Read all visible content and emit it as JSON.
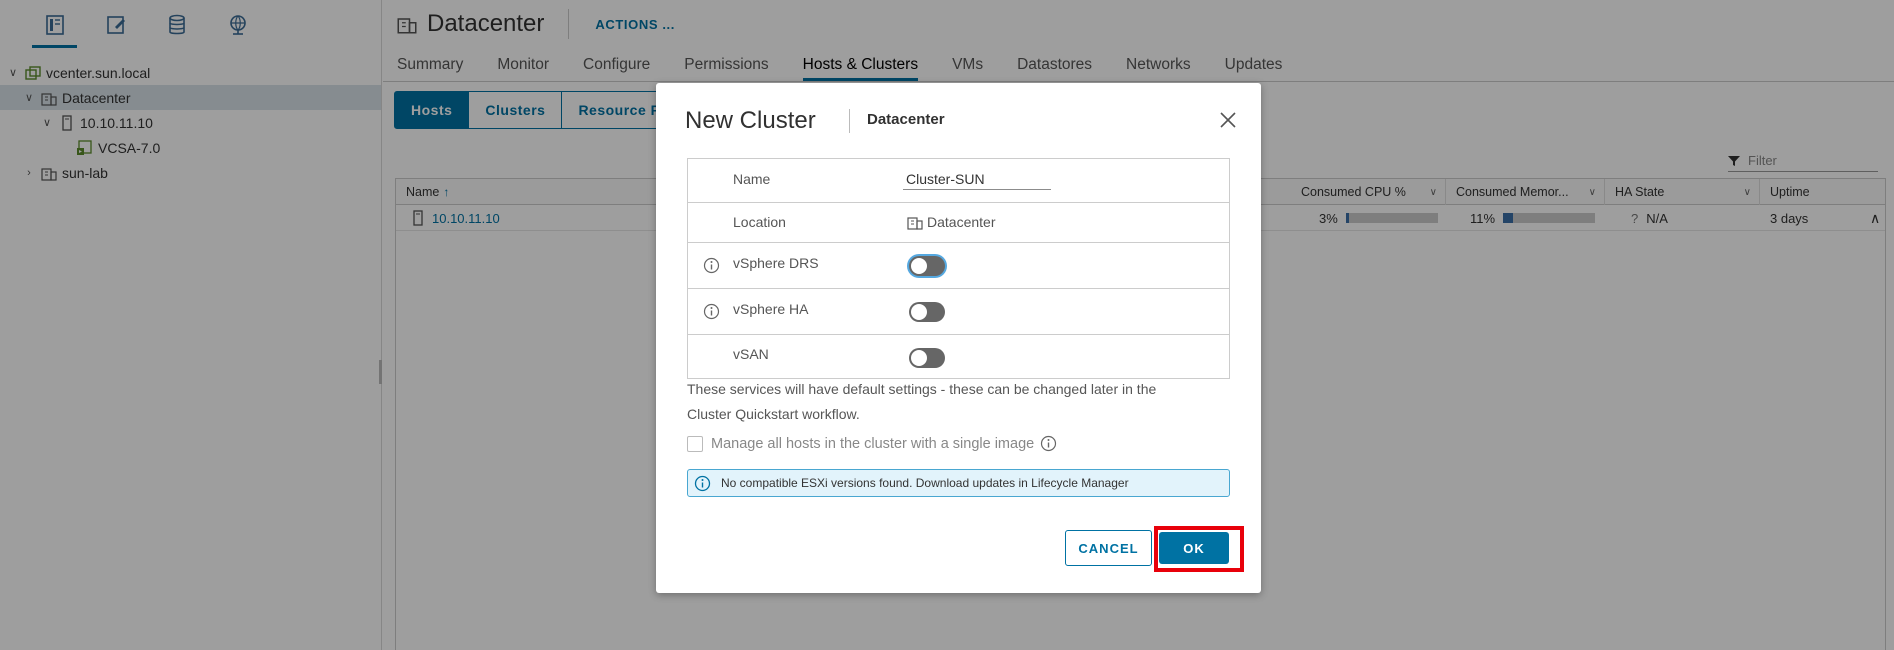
{
  "navigator": {
    "tabs": [
      "hosts-and-clusters",
      "vms-and-templates",
      "storage",
      "networking"
    ],
    "tree": [
      {
        "label": "vcenter.sun.local",
        "icon": "vcenter-icon",
        "level": 0,
        "expanded": true
      },
      {
        "label": "Datacenter",
        "icon": "datacenter-icon",
        "level": 1,
        "expanded": true,
        "selected": true
      },
      {
        "label": "10.10.11.10",
        "icon": "host-icon",
        "level": 2,
        "expanded": true
      },
      {
        "label": "VCSA-7.0",
        "icon": "vm-icon",
        "level": 3
      },
      {
        "label": "sun-lab",
        "icon": "datacenter-icon",
        "level": 1,
        "expanded": false
      }
    ]
  },
  "main": {
    "title": "Datacenter",
    "actions_label": "ACTIONS ...",
    "tabs": [
      "Summary",
      "Monitor",
      "Configure",
      "Permissions",
      "Hosts & Clusters",
      "VMs",
      "Datastores",
      "Networks",
      "Updates"
    ],
    "active_tab": "Hosts & Clusters",
    "subtabs": [
      "Hosts",
      "Clusters",
      "Resource Po"
    ],
    "filter_placeholder": "Filter",
    "grid": {
      "columns": [
        "Name",
        "Consumed CPU %",
        "Consumed Memor...",
        "HA State",
        "Uptime"
      ],
      "row": {
        "name": "10.10.11.10",
        "cpu": "3%",
        "cpu_fraction": 0.03,
        "memory": "11%",
        "memory_fraction": 0.11,
        "ha_icon": "?",
        "ha": "N/A",
        "uptime": "3 days"
      }
    }
  },
  "dialog": {
    "title": "New Cluster",
    "subtitle": "Datacenter",
    "fields": {
      "name_label": "Name",
      "name_value": "Cluster-SUN",
      "location_label": "Location",
      "location_value": "Datacenter",
      "drs_label": "vSphere DRS",
      "ha_label": "vSphere HA",
      "vsan_label": "vSAN"
    },
    "toggles": {
      "drs": false,
      "ha": false,
      "vsan": false
    },
    "note_line1": "These services will have default settings - these can be changed later in the",
    "note_line2": "Cluster Quickstart workflow.",
    "image_checkbox_label": "Manage all hosts in the cluster with a single image",
    "alert_text": "No compatible ESXi versions found. Download updates in Lifecycle Manager",
    "cancel_label": "CANCEL",
    "ok_label": "OK",
    "accent_color": "#0072a3",
    "highlight_color": "#e8000a"
  }
}
